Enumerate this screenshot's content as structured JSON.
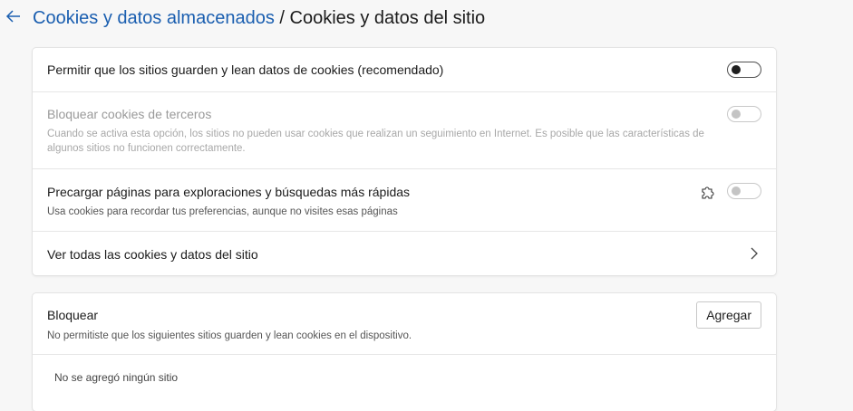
{
  "header": {
    "breadcrumb_parent": "Cookies y datos almacenados",
    "separator": " / ",
    "breadcrumb_current": "Cookies y datos del sitio"
  },
  "settings": {
    "allow_cookies": {
      "label": "Permitir que los sitios guarden y lean datos de cookies (recomendado)",
      "enabled": true,
      "state": "on"
    },
    "block_third_party": {
      "label": "Bloquear cookies de terceros",
      "description": "Cuando se activa esta opción, los sitios no pueden usar cookies que realizan un seguimiento en Internet. Es posible que las características de algunos sitios no funcionen correctamente.",
      "enabled": false,
      "state": "off"
    },
    "preload_pages": {
      "label": "Precargar páginas para exploraciones y búsquedas más rápidas",
      "description": "Usa cookies para recordar tus preferencias, aunque no visites esas páginas",
      "managed_icon": "puzzle-extension-icon",
      "enabled": false,
      "state": "off"
    },
    "view_all": {
      "label": "Ver todas las cookies y datos del sitio"
    }
  },
  "block_section": {
    "title": "Bloquear",
    "description": "No permitiste que los siguientes sitios guarden y lean cookies en el dispositivo.",
    "add_button": "Agregar",
    "empty_text": "No se agregó ningún sitio"
  },
  "colors": {
    "link": "#1b5fb0",
    "background": "#f7f7f7",
    "card": "#ffffff"
  }
}
